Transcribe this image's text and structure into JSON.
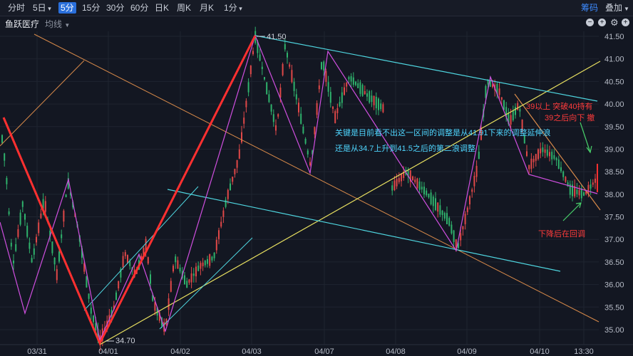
{
  "toolbar": {
    "timeframes": [
      {
        "label": "分时",
        "active": false
      },
      {
        "label": "5日",
        "active": false,
        "dropdown": true
      },
      {
        "label": "5分",
        "active": true
      },
      {
        "label": "15分",
        "active": false
      },
      {
        "label": "30分",
        "active": false
      },
      {
        "label": "60分",
        "active": false
      },
      {
        "label": "日K",
        "active": false
      },
      {
        "label": "周K",
        "active": false
      },
      {
        "label": "月K",
        "active": false
      },
      {
        "label": "1分",
        "active": false,
        "dropdown": true
      }
    ],
    "chip_label": "筹码",
    "chip_color": "#3d8bff",
    "adjust_label": "叠加",
    "adjust_icon": "chevron-down-icon"
  },
  "header": {
    "stock_name": "鱼跃医疗",
    "indicator_label": "均线",
    "indicator_icon": "chevron-down-icon",
    "controls": [
      "zoom-out-icon",
      "zoom-in-icon",
      "settings-icon",
      "add-icon"
    ]
  },
  "chart_data": {
    "type": "candlestick",
    "interval": "5分",
    "y_ticks": [
      "41.50",
      "41.00",
      "40.50",
      "40.00",
      "39.50",
      "39.00",
      "38.50",
      "38.00",
      "37.50",
      "37.00",
      "36.50",
      "36.00",
      "35.50",
      "35.00"
    ],
    "ylim": [
      34.8,
      41.6
    ],
    "x_ticks": [
      "03/31",
      "04/01",
      "04/02",
      "04/03",
      "04/07",
      "04/08",
      "04/09",
      "04/10",
      "13:30"
    ],
    "up_color": "#e04848",
    "down_color": "#2fb26c",
    "high_marker": {
      "label": "41.50",
      "value": 41.5
    },
    "low_marker": {
      "label": "34.70",
      "value": 34.7
    },
    "annotations": [
      {
        "text": "关键是目前看不出这一区间的调整是从41.91下来的调整延伸浪",
        "color": "#4fd6ff"
      },
      {
        "text": "还是从34.7上升到41.5之后的第二浪调整",
        "color": "#4fd6ff"
      },
      {
        "text": "39以上 突破40持有",
        "color": "#ff3b3b"
      },
      {
        "text": "39之后向下 撤",
        "color": "#ff3b3b"
      },
      {
        "text": "下降后在回调",
        "color": "#ff3b3b"
      }
    ],
    "line_colors": {
      "wave": "#ff3030",
      "zigzag": "#d04fe0",
      "channel": "#4fd6e0",
      "trend_up": "#e8e060",
      "trend_down": "#d88a4a"
    }
  }
}
